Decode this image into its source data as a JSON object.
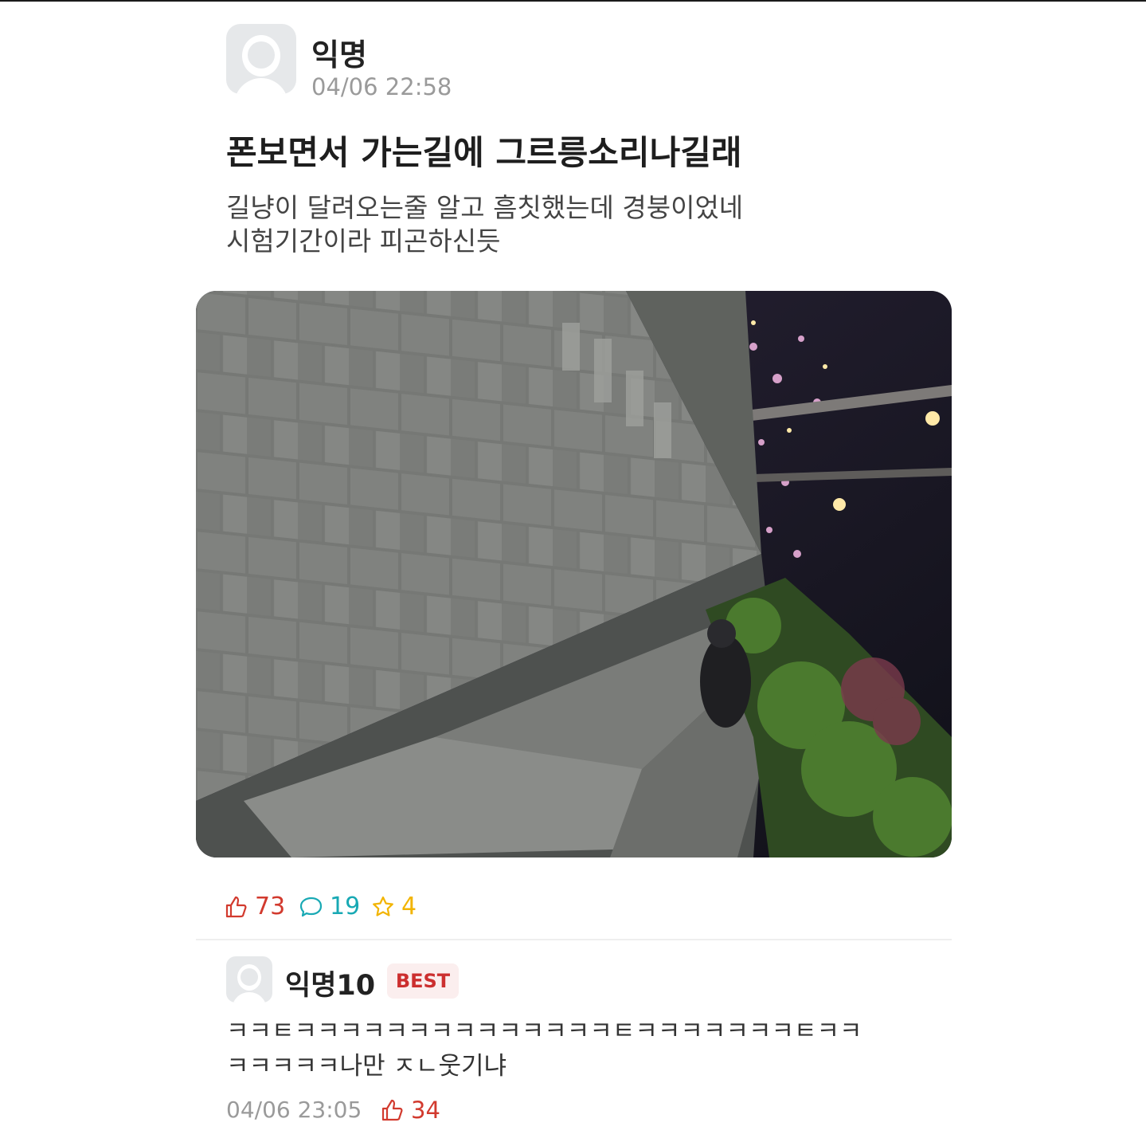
{
  "post": {
    "author": "익명",
    "time": "04/06 22:58",
    "title": "폰보면서 가는길에 그르릉소리나길래",
    "body_lines": [
      "길냥이 달려오는줄 알고 흠칫했는데 경붕이었네",
      "시험기간이라 피곤하신듯"
    ],
    "likes": "73",
    "comments": "19",
    "scraps": "4"
  },
  "comment": {
    "author": "익명10",
    "badge": "BEST",
    "text_lines": [
      "ㅋㅋㅌㅋㅋㅋㅋㅋㅋㅋㅋㅋㅋㅋㅋㅋㅋㅌㅋㅋㅋㅋㅋㅋㅋㅌㅋㅋ",
      "ㅋㅋㅋㅋㅋ나만 ㅈㄴ웃기냐"
    ],
    "time": "04/06 23:05",
    "likes": "34"
  },
  "colors": {
    "like": "#d23a2e",
    "comment": "#18a9b4",
    "scrap": "#f2b400",
    "badge_bg": "#fbeeee",
    "badge_text": "#cc2f2f"
  },
  "icons": {
    "like": "thumbs-up-icon",
    "comment": "speech-bubble-icon",
    "scrap": "star-icon"
  }
}
